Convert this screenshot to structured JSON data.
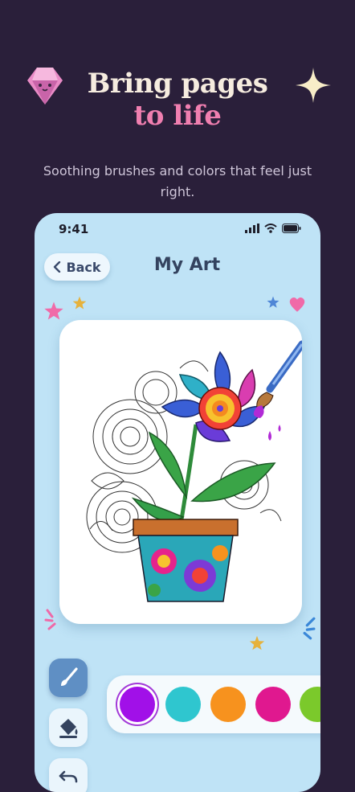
{
  "hero": {
    "line1": "Bring pages",
    "line2": "to life"
  },
  "subtitle": "Soothing brushes and colors that feel just right.",
  "status_bar": {
    "time": "9:41"
  },
  "header": {
    "back_label": "Back",
    "title": "My Art"
  },
  "palette": {
    "selected_index": 0,
    "colors": [
      "#a110e8",
      "#2fc6cf",
      "#f7921e",
      "#e0188f",
      "#7bc92b"
    ]
  },
  "tools": [
    "brush-icon",
    "paint-bucket-icon",
    "undo-icon"
  ],
  "colors": {
    "background": "#2a1f3a",
    "phone": "#bfe3f6",
    "accent_pink": "#f07fb0",
    "tool_active": "#5f8fc4"
  }
}
